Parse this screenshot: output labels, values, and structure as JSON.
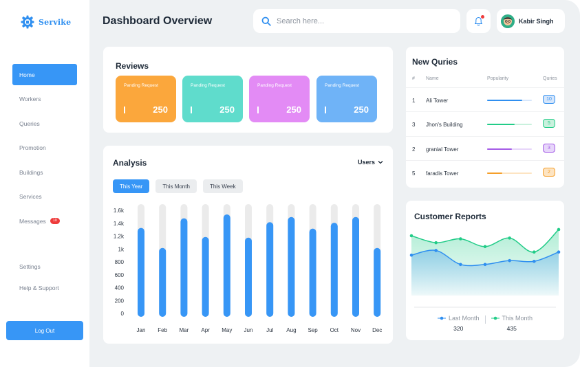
{
  "app": {
    "name": "Servike",
    "brand_color": "#2f8ff0"
  },
  "sidebar": {
    "items": [
      {
        "label": "Home",
        "active": true
      },
      {
        "label": "Workers"
      },
      {
        "label": "Queries"
      },
      {
        "label": "Promotion"
      },
      {
        "label": "Buildings"
      },
      {
        "label": "Services"
      },
      {
        "label": "Messages",
        "badge": "10"
      },
      {
        "label": "Settings"
      },
      {
        "label": "Help & Support"
      }
    ],
    "logout_label": "Log Out"
  },
  "header": {
    "title": "Dashboard Overview",
    "search_placeholder": "Search here...",
    "user_name": "Kabir Singh"
  },
  "reviews": {
    "title": "Reviews",
    "tiles": [
      {
        "label": "Panding Request",
        "value": "250",
        "color": "#fba73c"
      },
      {
        "label": "Panding Request",
        "value": "250",
        "color": "#5fdccc"
      },
      {
        "label": "Panding Request",
        "value": "250",
        "color": "#e38bf5"
      },
      {
        "label": "Panding Request",
        "value": "250",
        "color": "#6fb3f7"
      }
    ]
  },
  "analysis": {
    "title": "Analysis",
    "dropdown": "Users",
    "tabs": [
      {
        "label": "This Year",
        "active": true
      },
      {
        "label": "This Month"
      },
      {
        "label": "This Week"
      }
    ]
  },
  "chart_data": [
    {
      "type": "bar",
      "categories": [
        "Jan",
        "Feb",
        "Mar",
        "Apr",
        "May",
        "Jun",
        "Jul",
        "Aug",
        "Sep",
        "Oct",
        "Nov",
        "Dec"
      ],
      "values": [
        1380,
        1070,
        1530,
        1240,
        1590,
        1230,
        1470,
        1550,
        1370,
        1460,
        1550,
        1070
      ],
      "ylim": [
        0,
        1750
      ],
      "yticks": [
        {
          "v": 0,
          "label": "0"
        },
        {
          "v": 200,
          "label": "200"
        },
        {
          "v": 400,
          "label": "400"
        },
        {
          "v": 600,
          "label": "600"
        },
        {
          "v": 800,
          "label": "800"
        },
        {
          "v": 1000,
          "label": "1k"
        },
        {
          "v": 1200,
          "label": "1.2k"
        },
        {
          "v": 1400,
          "label": "1.4k"
        },
        {
          "v": 1600,
          "label": "1.6k"
        }
      ],
      "bar_color": "#3796f6",
      "track_color": "#ebebeb"
    },
    {
      "type": "area",
      "title": "Customer Reports",
      "x": [
        1,
        2,
        3,
        4,
        5,
        6,
        7
      ],
      "series": [
        {
          "name": "Last Month",
          "total": "320",
          "color": "#2f8ff0",
          "values": [
            52,
            58,
            40,
            40,
            45,
            44,
            56
          ]
        },
        {
          "name": "This Month",
          "total": "435",
          "color": "#22cc88",
          "values": [
            77,
            68,
            73,
            63,
            74,
            56,
            85
          ]
        }
      ],
      "ylim": [
        0,
        100
      ],
      "legend": "bottom"
    }
  ],
  "queries": {
    "title": "New Quries",
    "columns": [
      "#",
      "Name",
      "Popularity",
      "Quries"
    ],
    "rows": [
      {
        "num": "1",
        "name": "Ali Tower",
        "popularity": 0.78,
        "count": "10",
        "color": "#2f8ff0",
        "track": "#d6e6fb"
      },
      {
        "num": "3",
        "name": "Jhon's Building",
        "popularity": 0.62,
        "count": "5",
        "color": "#22cc88",
        "track": "#c9f1dd"
      },
      {
        "num": "2",
        "name": "granial Tower",
        "popularity": 0.55,
        "count": "3",
        "color": "#a45be6",
        "track": "#e7d6fa"
      },
      {
        "num": "5",
        "name": "faradis Tower",
        "popularity": 0.34,
        "count": "2",
        "color": "#f59f2a",
        "track": "#fde4c2"
      }
    ]
  }
}
